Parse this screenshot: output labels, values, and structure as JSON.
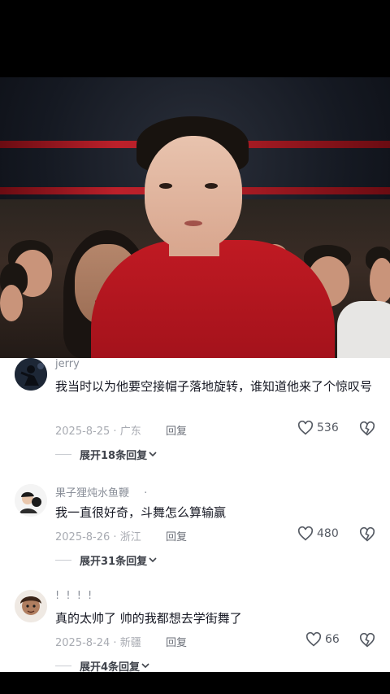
{
  "comments": [
    {
      "username": "jerry",
      "text": "我当时以为他要空接帽子落地旋转，谁知道他来了个惊叹号",
      "date": "2025-8-25",
      "location": "广东",
      "reply_label": "回复",
      "likes": "536",
      "expand_label": "展开18条回复",
      "avatar_icon": "avatar-dancer-icon"
    },
    {
      "username": "果子狸炖水鱼鞭",
      "username_suffix": "·",
      "text": "我一直很好奇，斗舞怎么算输赢",
      "date": "2025-8-26",
      "location": "浙江",
      "reply_label": "回复",
      "likes": "480",
      "expand_label": "展开31条回复",
      "avatar_icon": "avatar-cartoon-icon"
    },
    {
      "username": "! ! ! !",
      "text": "真的太帅了  帅的我都想去学街舞了",
      "date": "2025-8-24",
      "location": "新疆",
      "reply_label": "回复",
      "likes": "66",
      "expand_label": "展开4条回复",
      "avatar_icon": "avatar-cartoon-icon"
    }
  ],
  "colors": {
    "text_primary": "#161823",
    "text_secondary": "#a8abb2",
    "jacket_red": "#c01a23"
  }
}
